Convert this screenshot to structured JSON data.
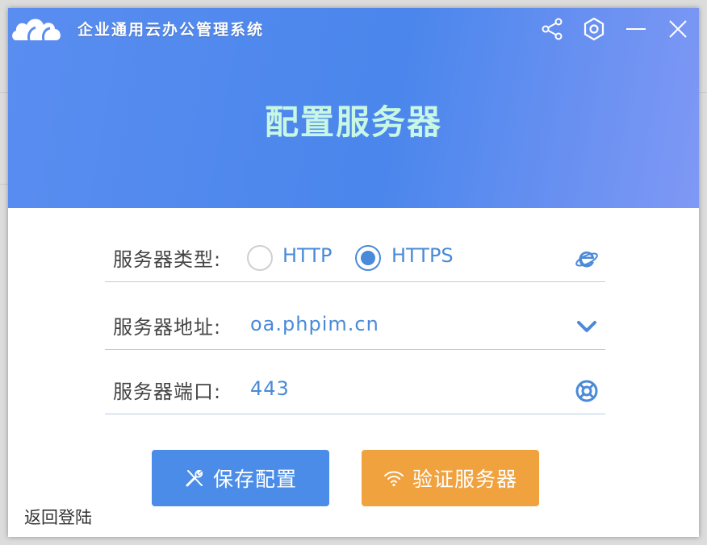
{
  "header": {
    "app_title": "企业通用云办公管理系统",
    "main_title": "配置服务器",
    "icons": [
      "share-icon",
      "settings-icon",
      "minimize-icon",
      "close-icon"
    ]
  },
  "form": {
    "type": {
      "label": "服务器类型:",
      "options": [
        {
          "label": "HTTP",
          "checked": false
        },
        {
          "label": "HTTPS",
          "checked": true
        }
      ],
      "icon": "ie-icon"
    },
    "address": {
      "label": "服务器地址:",
      "value": "oa.phpim.cn",
      "icon": "chevron-down-icon"
    },
    "port": {
      "label": "服务器端口:",
      "value": "443",
      "icon": "lifebuoy-icon"
    }
  },
  "actions": {
    "save_label": "保存配置",
    "verify_label": "验证服务器",
    "back_label": "返回登陆"
  },
  "colors": {
    "header_start": "#5a8df0",
    "header_end": "#7f98f5",
    "accent_blue": "#4a8ad8",
    "save_button": "#4a8ce8",
    "verify_button": "#f0a23e",
    "title_text": "#c8f7e4"
  }
}
